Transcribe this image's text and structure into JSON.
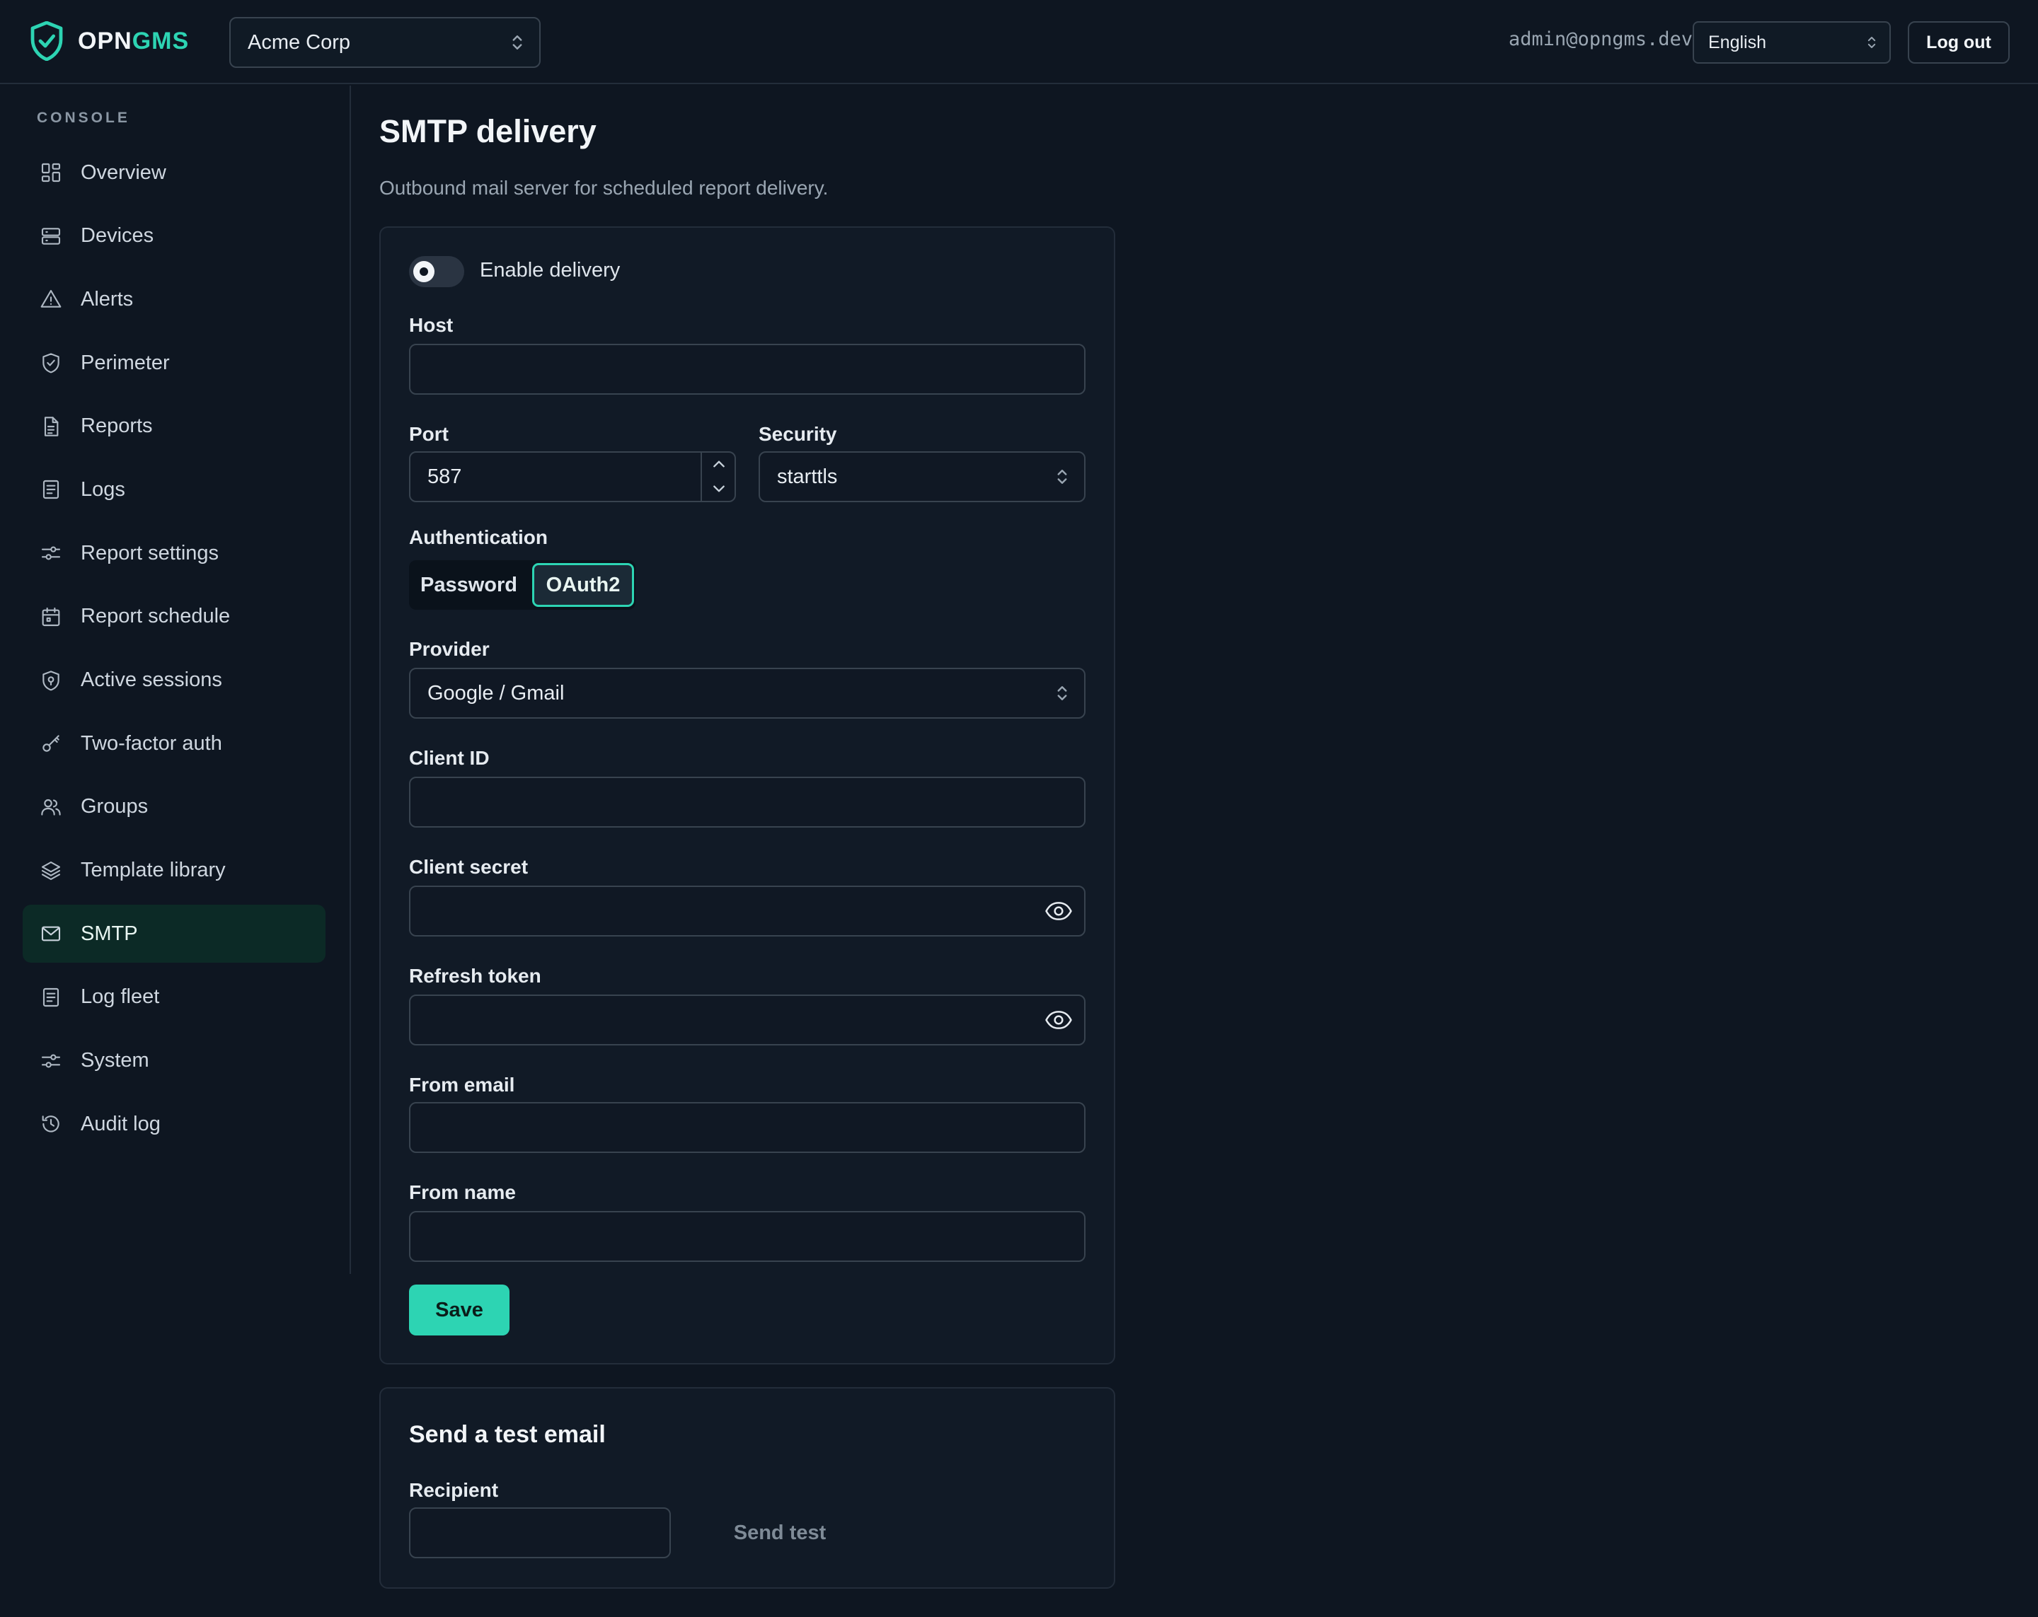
{
  "header": {
    "logo_part1": "OPN",
    "logo_part2": "GMS",
    "org": "Acme Corp",
    "user_email": "admin@opngms.dev",
    "language": "English",
    "logout_label": "Log out"
  },
  "sidebar": {
    "heading": "CONSOLE",
    "items": [
      {
        "label": "Overview",
        "icon": "grid-icon"
      },
      {
        "label": "Devices",
        "icon": "server-icon"
      },
      {
        "label": "Alerts",
        "icon": "warning-icon"
      },
      {
        "label": "Perimeter",
        "icon": "shield-check-icon"
      },
      {
        "label": "Reports",
        "icon": "file-text-icon"
      },
      {
        "label": "Logs",
        "icon": "list-icon"
      },
      {
        "label": "Report settings",
        "icon": "sliders-icon"
      },
      {
        "label": "Report schedule",
        "icon": "calendar-icon"
      },
      {
        "label": "Active sessions",
        "icon": "shield-pin-icon"
      },
      {
        "label": "Two-factor auth",
        "icon": "key-icon"
      },
      {
        "label": "Groups",
        "icon": "users-icon"
      },
      {
        "label": "Template library",
        "icon": "layers-icon"
      },
      {
        "label": "SMTP",
        "icon": "mail-icon",
        "active": true
      },
      {
        "label": "Log fleet",
        "icon": "list-icon"
      },
      {
        "label": "System",
        "icon": "sliders-icon"
      },
      {
        "label": "Audit log",
        "icon": "history-icon"
      }
    ]
  },
  "main": {
    "title": "SMTP delivery",
    "subtitle": "Outbound mail server for scheduled report delivery.",
    "enable_label": "Enable delivery",
    "enabled": false,
    "host_label": "Host",
    "host_value": "",
    "port_label": "Port",
    "port_value": "587",
    "security_label": "Security",
    "security_value": "starttls",
    "auth_label": "Authentication",
    "auth_password": "Password",
    "auth_oauth2": "OAuth2",
    "auth_selected": "OAuth2",
    "provider_label": "Provider",
    "provider_value": "Google / Gmail",
    "client_id_label": "Client ID",
    "client_secret_label": "Client secret",
    "refresh_token_label": "Refresh token",
    "from_email_label": "From email",
    "from_name_label": "From name",
    "save_label": "Save"
  },
  "test": {
    "title": "Send a test email",
    "recipient_label": "Recipient",
    "recipient_value": "",
    "send_label": "Send test"
  },
  "colors": {
    "accent": "#2dd4b3",
    "background": "#0e1621",
    "card": "#111a26",
    "active_nav": "#0c2a26"
  }
}
